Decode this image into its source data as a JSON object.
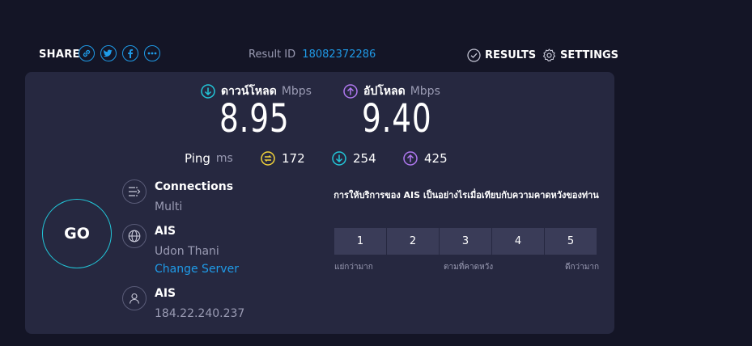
{
  "header": {
    "share_label": "SHARE",
    "share_icons": [
      "link-icon",
      "twitter-icon",
      "facebook-icon",
      "more-icon"
    ],
    "result_label": "Result ID",
    "result_id": "18082372286",
    "results_label": "RESULTS",
    "settings_label": "SETTINGS"
  },
  "download": {
    "label": "ดาวน์โหลด",
    "unit": "Mbps",
    "value": "8.95"
  },
  "upload": {
    "label": "อัปโหลด",
    "unit": "Mbps",
    "value": "9.40"
  },
  "ping": {
    "label": "Ping",
    "unit": "ms",
    "idle": "172",
    "download": "254",
    "upload": "425"
  },
  "go_label": "GO",
  "connections": {
    "title": "Connections",
    "value": "Multi"
  },
  "server": {
    "title": "AIS",
    "location": "Udon Thani",
    "change_label": "Change Server"
  },
  "provider": {
    "title": "AIS",
    "ip": "184.22.240.237"
  },
  "survey": {
    "question": "การให้บริการของ AIS เป็นอย่างไรเมื่อเทียบกับความคาดหวังของท่าน",
    "ratings": [
      "1",
      "2",
      "3",
      "4",
      "5"
    ],
    "low_label": "แย่กว่ามาก",
    "mid_label": "ตามที่คาดหวัง",
    "high_label": "ดีกว่ามาก"
  },
  "colors": {
    "accent_blue": "#1f9be8",
    "download_teal": "#22c7d9",
    "upload_purple": "#b078f0",
    "ping_yellow": "#f2d33a",
    "panel_bg": "#262840",
    "page_bg": "#141526"
  }
}
